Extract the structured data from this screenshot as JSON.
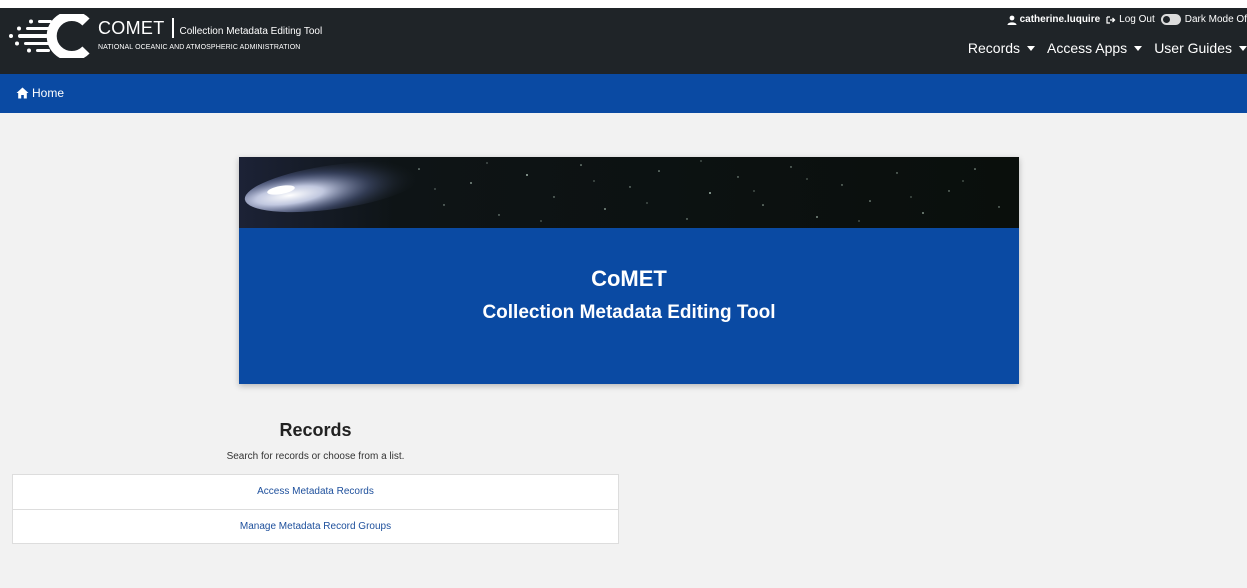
{
  "header": {
    "brand_name": "COMET",
    "brand_tagline": "Collection Metadata Editing Tool",
    "org_name": "NATIONAL OCEANIC AND ATMOSPHERIC ADMINISTRATION",
    "user": {
      "username": "catherine.luquire",
      "logout_label": "Log Out",
      "dark_mode_label": "Dark Mode Of"
    },
    "nav": [
      {
        "label": "Records"
      },
      {
        "label": "Access Apps"
      },
      {
        "label": "User Guides"
      }
    ]
  },
  "breadcrumb": {
    "home_label": "Home"
  },
  "hero": {
    "title": "CoMET",
    "subtitle": "Collection Metadata Editing Tool"
  },
  "records": {
    "heading": "Records",
    "description": "Search for records or choose from a list.",
    "items": [
      {
        "label": "Access Metadata Records"
      },
      {
        "label": "Manage Metadata Record Groups"
      }
    ]
  },
  "colors": {
    "header_bg": "#1f2428",
    "brand_blue": "#0a4aa3",
    "page_bg": "#f2f2f2",
    "link": "#1d4f9c"
  }
}
